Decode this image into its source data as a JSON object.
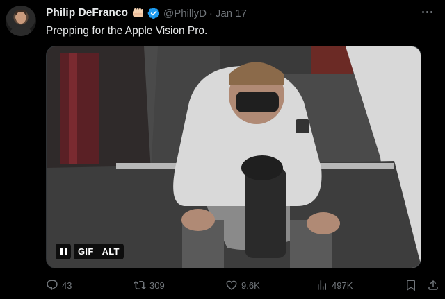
{
  "tweet": {
    "author_name": "Philip DeFranco",
    "handle": "@PhillyD",
    "separator": "·",
    "date": "Jan 17",
    "text": "Prepping for the Apple Vision Pro."
  },
  "media": {
    "type": "gif",
    "pause_label": "pause",
    "gif_label": "GIF",
    "alt_label": "ALT"
  },
  "actions": {
    "replies": "43",
    "reposts": "309",
    "likes": "9.6K",
    "views": "497K"
  },
  "colors": {
    "background": "#000000",
    "primary_text": "#e7e9ea",
    "secondary_text": "#71767b",
    "verified_blue": "#1d9bf0"
  },
  "icons": [
    "fist-emoji-icon",
    "verified-badge-icon",
    "more-icon",
    "reply-icon",
    "repost-icon",
    "like-icon",
    "views-icon",
    "bookmark-icon",
    "share-icon"
  ]
}
